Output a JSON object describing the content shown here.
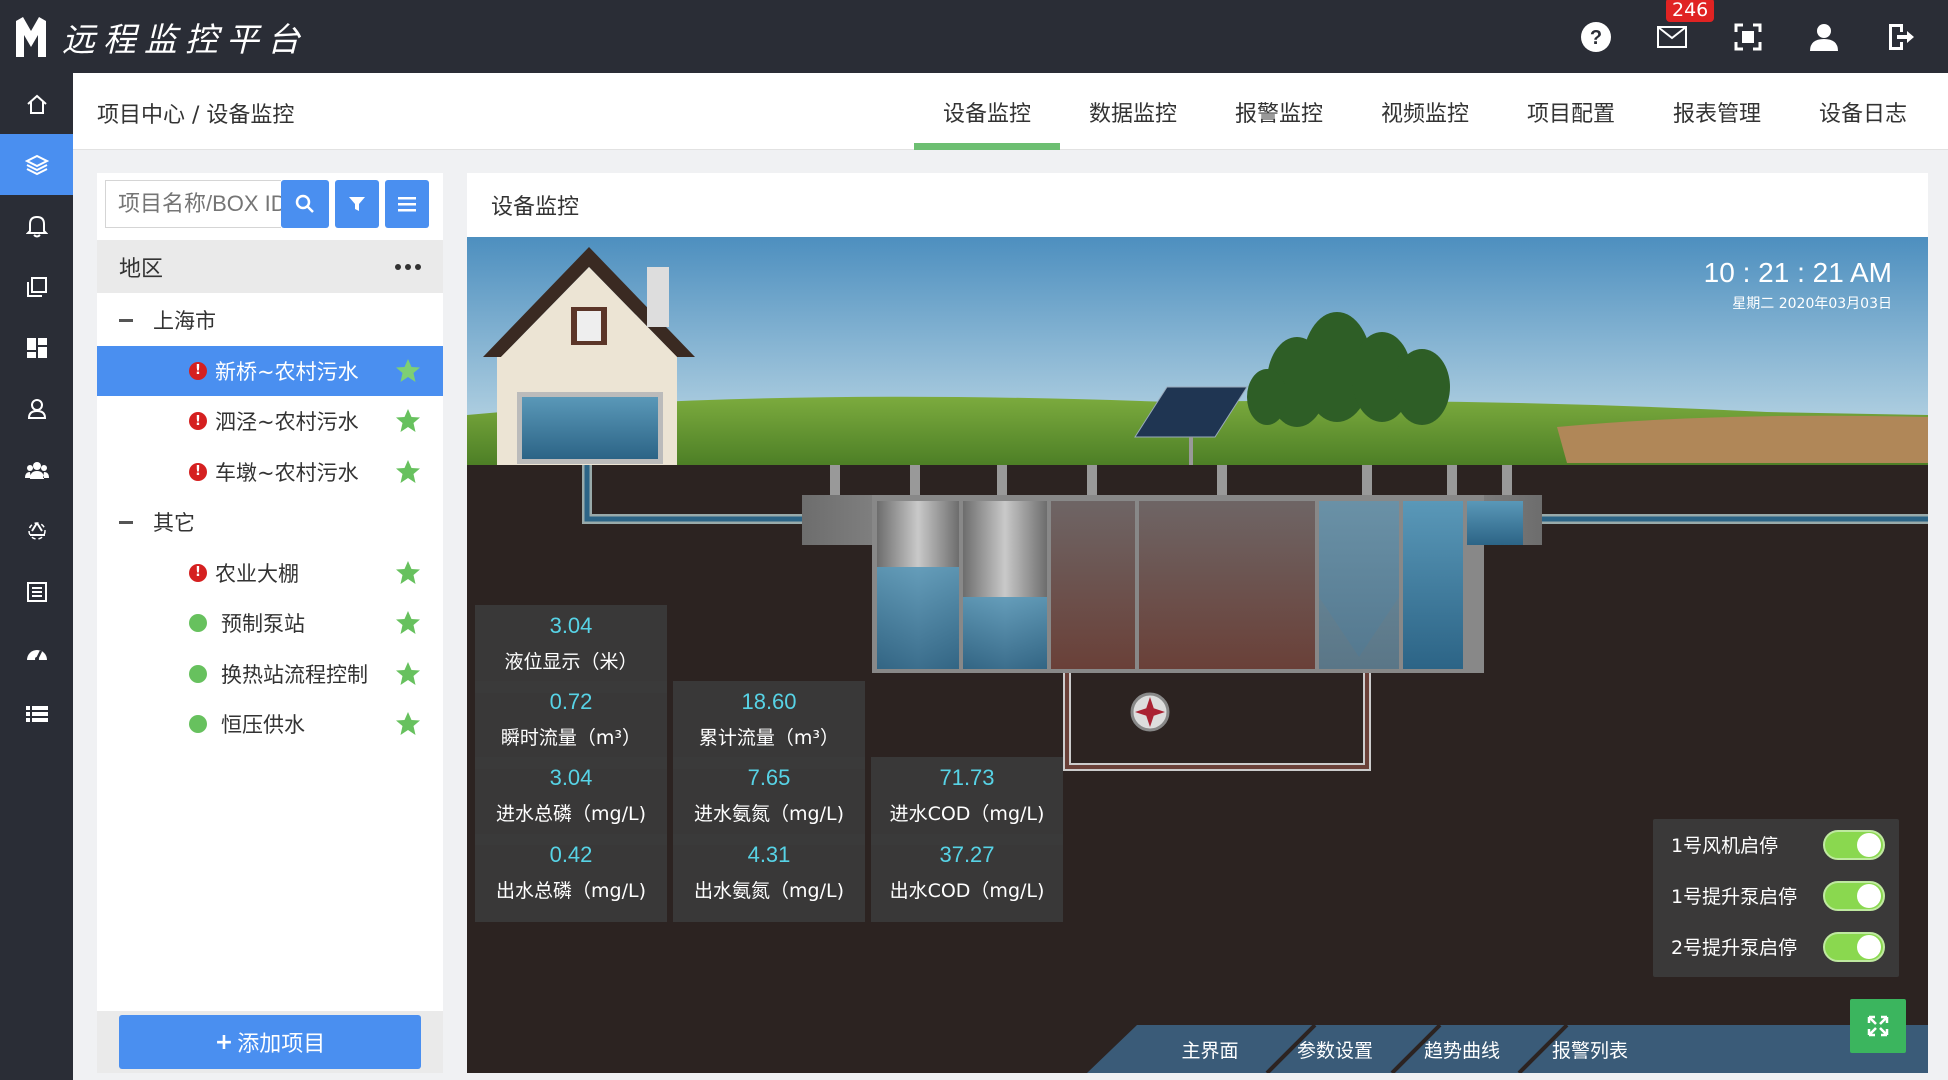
{
  "app": {
    "title": "远程监控平台",
    "badge_count": "246"
  },
  "topbar": {
    "icons": [
      "help-icon",
      "mail-icon",
      "fullscreen-icon",
      "user-icon",
      "logout-icon"
    ]
  },
  "sidebar": {
    "items": [
      "home-icon",
      "layers-icon",
      "bell-icon",
      "copy-icon",
      "dashboard-icon",
      "user-location-icon",
      "group-icon",
      "recycle-icon",
      "list-alt-icon",
      "gauge-icon",
      "list-icon"
    ],
    "active_index": 1
  },
  "navbar": {
    "breadcrumb": "项目中心 / 设备监控",
    "tabs": [
      "设备监控",
      "数据监控",
      "报警监控",
      "视频监控",
      "项目配置",
      "报表管理",
      "设备日志"
    ],
    "active_tab": 0
  },
  "left": {
    "search_placeholder": "项目名称/BOX ID",
    "region_header": "地区",
    "groups": [
      {
        "label": "上海市",
        "items": [
          {
            "label": "新桥~农村污水",
            "status": "alert",
            "selected": true
          },
          {
            "label": "泗泾~农村污水",
            "status": "alert"
          },
          {
            "label": "车墩~农村污水",
            "status": "alert"
          }
        ]
      },
      {
        "label": "其它",
        "items": [
          {
            "label": "农业大棚",
            "status": "alert"
          },
          {
            "label": "预制泵站",
            "status": "ok"
          },
          {
            "label": "换热站流程控制",
            "status": "ok"
          },
          {
            "label": "恒压供水",
            "status": "ok"
          }
        ]
      }
    ],
    "add_button": "添加项目"
  },
  "main": {
    "title": "设备监控",
    "clock": {
      "time": "10 : 21 : 21  AM",
      "date": "星期二   2020年03月03日"
    },
    "metrics": [
      {
        "value": "3.04",
        "label": "液位显示（米）"
      },
      {
        "value": "0.72",
        "label": "瞬时流量（m³）"
      },
      {
        "value": "18.60",
        "label": "累计流量（m³）"
      },
      {
        "value": "3.04",
        "label": "进水总磷（mg/L)"
      },
      {
        "value": "7.65",
        "label": "进水氨氮（mg/L)"
      },
      {
        "value": "71.73",
        "label": "进水COD（mg/L)"
      },
      {
        "value": "0.42",
        "label": "出水总磷（mg/L)"
      },
      {
        "value": "4.31",
        "label": "出水氨氮（mg/L)"
      },
      {
        "value": "37.27",
        "label": "出水COD（mg/L)"
      }
    ],
    "switches": [
      {
        "label": "1号风机启停",
        "on": true
      },
      {
        "label": "1号提升泵启停",
        "on": true
      },
      {
        "label": "2号提升泵启停",
        "on": true
      }
    ],
    "bottom_tabs": [
      "主界面",
      "参数设置",
      "趋势曲线",
      "报警列表"
    ]
  },
  "colors": {
    "accent": "#4a8ff0",
    "topbar": "#2a2d36",
    "tab_underline": "#6dbf72",
    "metric_value": "#57d3e6",
    "toggle_on": "#8ad84f"
  }
}
